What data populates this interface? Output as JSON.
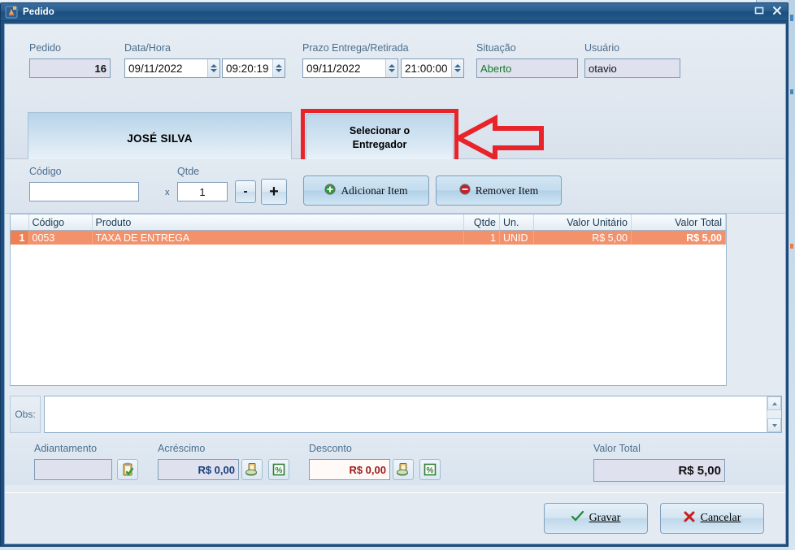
{
  "window": {
    "title": "Pedido",
    "icon": "app-icon",
    "buttons": {
      "maximize": "maximize-icon",
      "close": "close-icon"
    }
  },
  "header": {
    "fields": [
      {
        "key": "pedido",
        "label": "Pedido",
        "value": "16"
      },
      {
        "key": "data",
        "label": "Data/Hora",
        "value": "09/11/2022"
      },
      {
        "key": "hora",
        "label": "",
        "value": "09:20:19"
      },
      {
        "key": "prazo",
        "label": "Prazo Entrega/Retirada",
        "value": "09/11/2022"
      },
      {
        "key": "prazo_h",
        "label": "",
        "value": "21:00:00"
      },
      {
        "key": "situacao",
        "label": "Situação",
        "value": "Aberto"
      },
      {
        "key": "usuario",
        "label": "Usuário",
        "value": "otavio"
      }
    ],
    "customer_name": "JOSÉ SILVA",
    "select_courier_button": {
      "line1": "Selecionar o",
      "line2": "Entregador"
    }
  },
  "annotation": {
    "color": "#e8232a",
    "shape_rect": "highlight-rectangle",
    "shape_arrow": "pointer-arrow-left"
  },
  "entry": {
    "codigo_label": "Código",
    "codigo_value": "",
    "multiply_symbol": "x",
    "qtde_label": "Qtde",
    "qtde_value": "1",
    "minus_label": "-",
    "plus_label": "+",
    "add_item_label": "Adicionar Item",
    "remove_item_label": "Remover Item"
  },
  "grid": {
    "columns": [
      "",
      "Código",
      "Produto",
      "Qtde",
      "Un.",
      "Valor Unitário",
      "Valor Total"
    ],
    "rows": [
      {
        "index": "1",
        "codigo": "0053",
        "produto": "TAXA DE ENTREGA",
        "qtde": "1",
        "un": "UNID",
        "valor_unitario": "R$ 5,00",
        "valor_total": "R$ 5,00"
      }
    ],
    "selected_row_color": "#f2916a"
  },
  "obs": {
    "label": "Obs:",
    "value": ""
  },
  "totals": {
    "adiantamento_label": "Adiantamento",
    "adiantamento_value": "",
    "adiantamento_icon": "clipboard-check-icon",
    "acrescimo_label": "Acréscimo",
    "acrescimo_value": "R$ 0,00",
    "acrescimo_icon_money": "money-clipboard-icon",
    "acrescimo_icon_percent": "percent-icon",
    "desconto_label": "Desconto",
    "desconto_value": "R$ 0,00",
    "desconto_icon_money": "money-clipboard-icon",
    "desconto_icon_percent": "percent-icon",
    "valor_total_label": "Valor Total",
    "valor_total_value": "R$ 5,00"
  },
  "footer": {
    "save_label": "Gravar",
    "save_icon": "check-icon",
    "cancel_label": "Cancelar",
    "cancel_icon": "x-icon"
  }
}
